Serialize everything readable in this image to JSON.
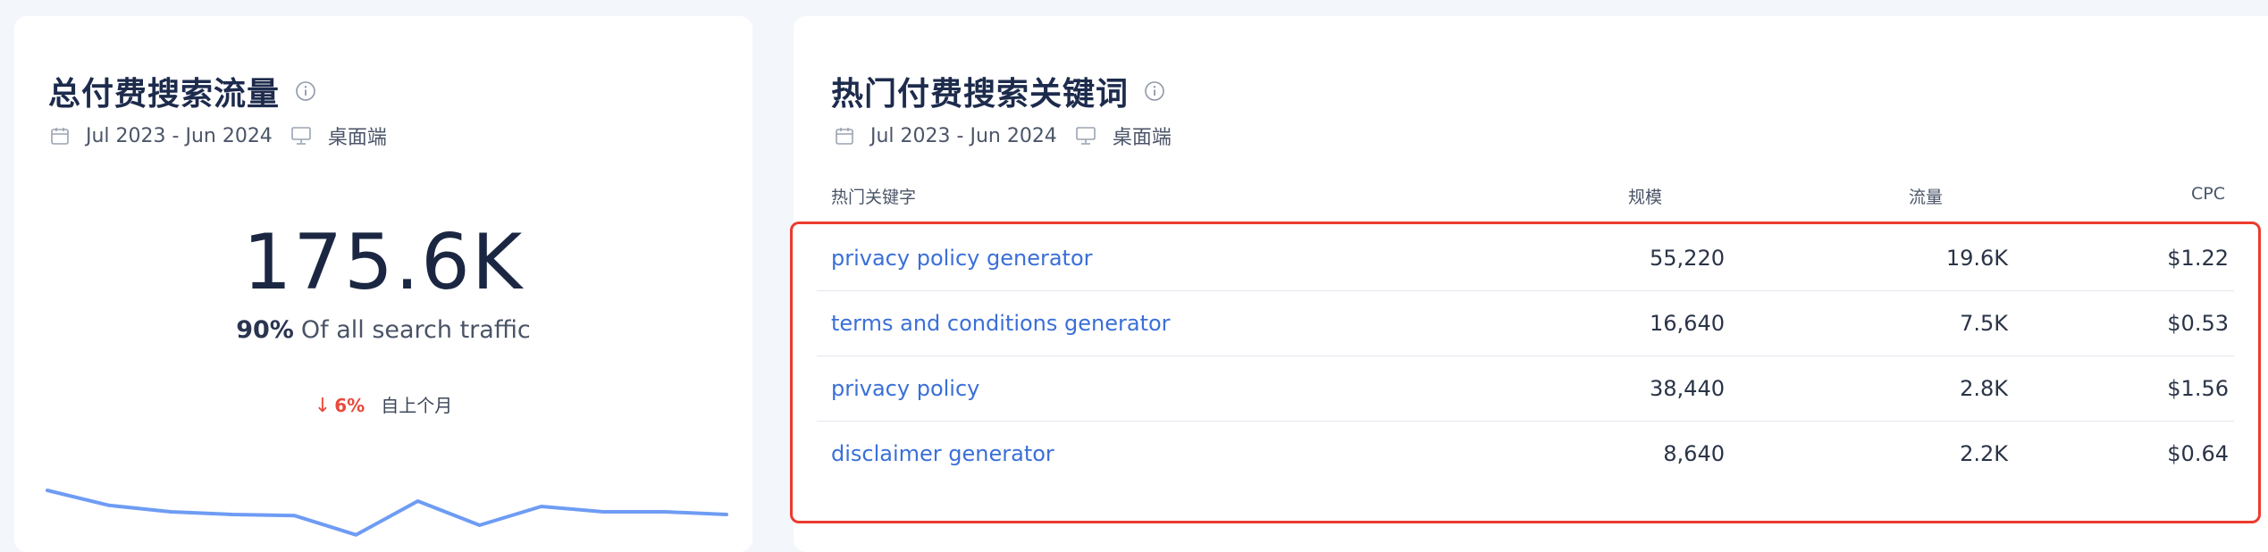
{
  "left_card": {
    "title": "总付费搜索流量",
    "date_range": "Jul 2023 - Jun 2024",
    "device": "桌面端",
    "total_value": "175.6K",
    "share_pct": "90%",
    "share_text": "Of all search traffic",
    "trend_arrow": "↓",
    "trend_delta": "6%",
    "trend_text": "自上个月",
    "sparkline": [
      0.1,
      0.38,
      0.5,
      0.55,
      0.57,
      0.93,
      0.3,
      0.75,
      0.4,
      0.5,
      0.5,
      0.55
    ],
    "line_color": "#6e9cf4"
  },
  "right_card": {
    "title": "热门付费搜索关键词",
    "date_range": "Jul 2023 - Jun 2024",
    "device": "桌面端",
    "columns": {
      "keyword": "热门关键字",
      "volume": "规模",
      "traffic": "流量",
      "cpc": "CPC"
    },
    "rows": [
      {
        "keyword": "privacy policy generator",
        "volume": "55,220",
        "traffic": "19.6K",
        "cpc": "$1.22"
      },
      {
        "keyword": "terms and conditions generator",
        "volume": "16,640",
        "traffic": "7.5K",
        "cpc": "$0.53"
      },
      {
        "keyword": "privacy policy",
        "volume": "38,440",
        "traffic": "2.8K",
        "cpc": "$1.56"
      },
      {
        "keyword": "disclaimer generator",
        "volume": "8,640",
        "traffic": "2.2K",
        "cpc": "$0.64"
      }
    ],
    "highlight_color": "#ec3b2d",
    "link_color": "#3a6fd8"
  },
  "icons": {
    "info": "info-icon",
    "calendar": "calendar-icon",
    "desktop": "desktop-icon",
    "trend": "arrow-down-icon"
  }
}
